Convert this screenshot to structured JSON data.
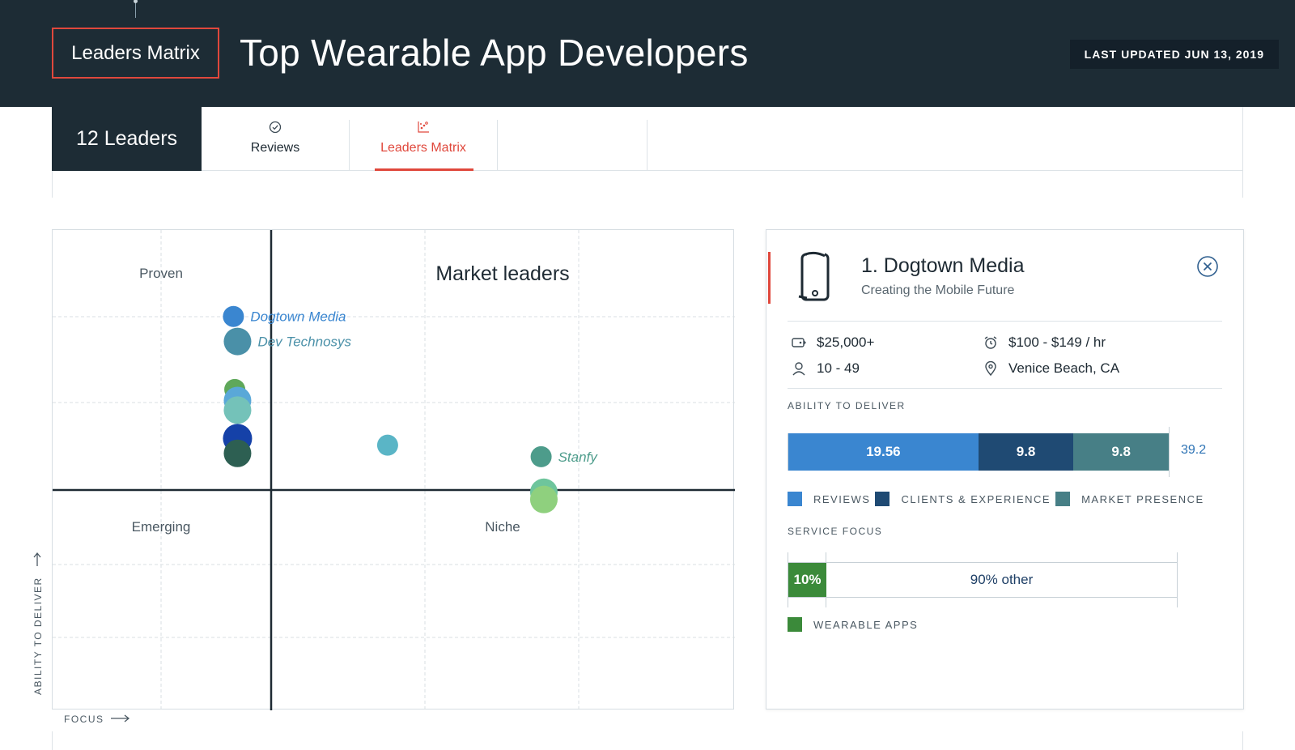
{
  "header": {
    "badge": "Leaders Matrix",
    "title": "Top Wearable App Developers",
    "last_updated": "LAST UPDATED JUN 13, 2019"
  },
  "tabs": {
    "count_label": "12 Leaders",
    "items": [
      {
        "label": "Reviews",
        "icon": "check-circle-icon",
        "active": false
      },
      {
        "label": "Leaders Matrix",
        "icon": "scatter-icon",
        "active": true
      }
    ]
  },
  "matrix": {
    "quadrants": {
      "top_left": "Proven",
      "top_right": "Market leaders",
      "bottom_left": "Emerging",
      "bottom_right": "Niche"
    },
    "y_axis": "ABILITY TO DELIVER",
    "x_axis": "FOCUS",
    "points": [
      {
        "label": "Dogtown Media",
        "color": "#3a86d0",
        "r": 13,
        "fx": 0.265,
        "fy": 0.18
      },
      {
        "label": "Dev Technosys",
        "color": "#4a90a8",
        "r": 17,
        "fx": 0.271,
        "fy": 0.232
      },
      {
        "label": "",
        "color": "#5fa85a",
        "r": 13,
        "fx": 0.267,
        "fy": 0.332
      },
      {
        "label": "",
        "color": "#5aa8d8",
        "r": 17,
        "fx": 0.271,
        "fy": 0.355
      },
      {
        "label": "",
        "color": "#74c2b9",
        "r": 17,
        "fx": 0.271,
        "fy": 0.375
      },
      {
        "label": "",
        "color": "#1541a8",
        "r": 18,
        "fx": 0.271,
        "fy": 0.434
      },
      {
        "label": "",
        "color": "#2d5f52",
        "r": 17,
        "fx": 0.271,
        "fy": 0.465
      },
      {
        "label": "",
        "color": "#5ab5c6",
        "r": 13,
        "fx": 0.491,
        "fy": 0.448
      },
      {
        "label": "Stanfy",
        "color": "#4d9c8b",
        "r": 13,
        "fx": 0.716,
        "fy": 0.472
      },
      {
        "label": "",
        "color": "#6ec59c",
        "r": 17,
        "fx": 0.72,
        "fy": 0.546
      },
      {
        "label": "",
        "color": "#8fd07e",
        "r": 17,
        "fx": 0.72,
        "fy": 0.561
      }
    ]
  },
  "panel": {
    "rank_name": "1. Dogtown Media",
    "tagline": "Creating the Mobile Future",
    "min_project": "$25,000+",
    "hourly_rate": "$100 - $149 / hr",
    "employees": "10 - 49",
    "location": "Venice Beach, CA",
    "ability_label": "ABILITY TO DELIVER",
    "ability": {
      "segments": [
        {
          "name": "REVIEWS",
          "value": "19.56",
          "num": 19.56,
          "color": "#3a86d0"
        },
        {
          "name": "CLIENTS & EXPERIENCE",
          "value": "9.8",
          "num": 9.8,
          "color": "#1f4a73"
        },
        {
          "name": "MARKET PRESENCE",
          "value": "9.8",
          "num": 9.8,
          "color": "#477f86"
        }
      ],
      "total": "39.2"
    },
    "service_focus_label": "SERVICE FOCUS",
    "service_focus": {
      "filled_label": "10%",
      "filled_pct": 10,
      "rest_label": "90% other",
      "legend": "WEARABLE APPS",
      "color": "#3b8a3a"
    }
  }
}
